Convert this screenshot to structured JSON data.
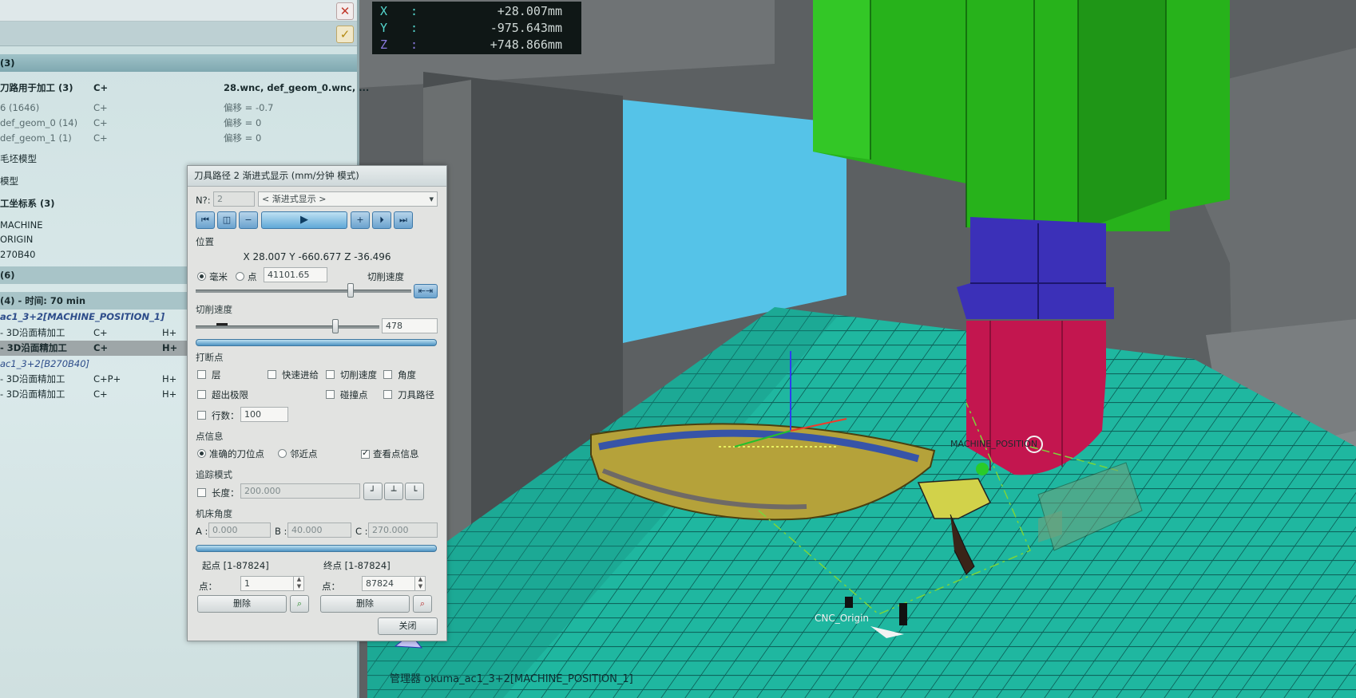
{
  "coords": [
    {
      "axis": "X",
      "value": "+28.007mm"
    },
    {
      "axis": "Y",
      "value": "-975.643mm"
    },
    {
      "axis": "Z",
      "value": "+748.866mm"
    }
  ],
  "tree": {
    "rows": [
      {
        "c1": "(3)",
        "style": "header"
      },
      {
        "c1": "刀路用于加工 (3)",
        "c2": "C+",
        "c4": "28.wnc, def_geom_0.wnc, ...",
        "style": "bold"
      },
      {
        "c1": "6 (1646)",
        "c2": "C+",
        "c4": "偏移 = -0.7",
        "style": "dim"
      },
      {
        "c1": "def_geom_0 (14)",
        "c2": "C+",
        "c4": "偏移 = 0",
        "style": "dim"
      },
      {
        "c1": "def_geom_1 (1)",
        "c2": "C+",
        "c4": "偏移 = 0",
        "style": "dim"
      },
      {
        "c1": "毛坯模型",
        "style": "normal"
      },
      {
        "c1": "模型",
        "style": "normal"
      },
      {
        "c1": "工坐标系 (3)",
        "style": "bold"
      },
      {
        "c1": "MACHINE",
        "style": "normal"
      },
      {
        "c1": "ORIGIN",
        "style": "normal"
      },
      {
        "c1": "270B40",
        "style": "normal"
      },
      {
        "c1": "(6)",
        "style": "section"
      },
      {
        "c1": "(4) - 时间: 70 min",
        "style": "section"
      },
      {
        "c1": "ac1_3+2[MACHINE_POSITION_1]",
        "style": "italic-bold"
      },
      {
        "c1": "- 3D沿面精加工",
        "c2": "C+",
        "c3": "H+",
        "style": "normal"
      },
      {
        "c1": "- 3D沿面精加工",
        "c2": "C+",
        "c3": "H+",
        "style": "selected"
      },
      {
        "c1": "ac1_3+2[B270B40]",
        "style": "italic"
      },
      {
        "c1": "- 3D沿面精加工",
        "c2": "C+P+",
        "c3": "H+",
        "style": "normal"
      },
      {
        "c1": "- 3D沿面精加工",
        "c2": "C+",
        "c3": "H+",
        "style": "normal"
      }
    ]
  },
  "dialog": {
    "title": "刀具路径 2 渐进式显示 (mm/分钟 模式)",
    "n_label": "N?:",
    "n_value": "2",
    "mode_select": "< 渐进式显示 >",
    "position_label": "位置",
    "position_value": "X 28.007 Y -660.677 Z -36.496",
    "radio_mm": "毫米",
    "radio_point": "点",
    "position_field": "41101.65",
    "cut_speed_link": "切削速度",
    "slider_position": 0.72,
    "speed_label": "切削速度",
    "speed_value": "478",
    "speed_slider": 0.76,
    "breakpoint_label": "打断点",
    "cb_layer": "层",
    "cb_rapid": "快速进给",
    "cb_cutspeed": "切削速度",
    "cb_angle": "角度",
    "cb_overtravel": "超出极限",
    "cb_collision": "碰撞点",
    "cb_toolpath": "刀具路径",
    "cb_lines": "行数：",
    "lines_value": "100",
    "point_info_label": "点信息",
    "radio_exact": "准确的刀位点",
    "radio_near": "邻近点",
    "cb_view_point": "查看点信息",
    "trace_label": "追踪模式",
    "cb_length": "长度：",
    "length_value": "200.000",
    "machine_angle_label": "机床角度",
    "angle_a_label": "A :",
    "angle_a": "0.000",
    "angle_b_label": "B :",
    "angle_b": "40.000",
    "angle_c_label": "C :",
    "angle_c": "270.000",
    "start_label": "起点 [1-87824]",
    "end_label": "终点 [1-87824]",
    "point_label": "点：",
    "start_value": "1",
    "end_value": "87824",
    "delete_label": "删除",
    "close_label": "关闭"
  },
  "viewport": {
    "origin_label": "CNC_Origin",
    "machine_pos_label": "MACHINE_POSITION",
    "status_text": "管理器 okuma_ac1_3+2[MACHINE_POSITION_1]"
  },
  "colors": {
    "head_green": "#26b31a",
    "spindle_blue": "#3a2fb8",
    "tool_red": "#c4164f",
    "table_teal": "#1cb39b",
    "sky": "#58c4ea"
  }
}
